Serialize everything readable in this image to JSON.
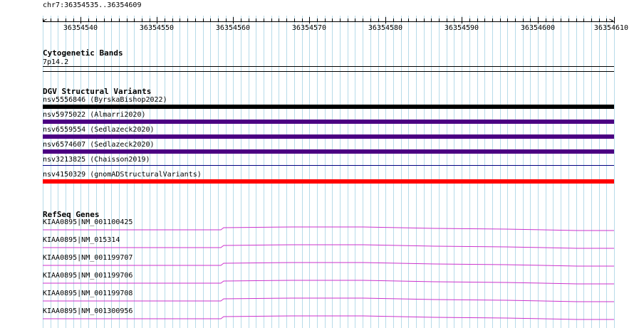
{
  "browser": {
    "position": "chr7:36354535..36354609",
    "ruler_ticks": [
      "36354540",
      "36354550",
      "36354560",
      "36354570",
      "36354580",
      "36354590",
      "36354600",
      "36354610"
    ]
  },
  "tracks": {
    "cytobands": {
      "title": "Cytogenetic Bands",
      "band": "7p14.2"
    },
    "dgv": {
      "title": "DGV Structural Variants",
      "items": [
        {
          "label": "nsv5556846 (ByrskaBishop2022)",
          "color": "#000000"
        },
        {
          "label": "nsv5975022 (Almarri2020)",
          "color": "#4b0082"
        },
        {
          "label": "nsv6559554 (Sedlazeck2020)",
          "color": "#4b0082"
        },
        {
          "label": "nsv6574607 (Sedlazeck2020)",
          "color": "#4b0082"
        },
        {
          "label": "nsv3213825 (Chaisson2019)",
          "color": "#000080"
        },
        {
          "label": "nsv4150329 (gnomADStructuralVariants)",
          "color": "#ff0000"
        }
      ]
    },
    "refseq": {
      "title": "RefSeq Genes",
      "line_color": "#cc33cc",
      "items": [
        {
          "label": "KIAA0895|NM_001100425"
        },
        {
          "label": "KIAA0895|NM_015314"
        },
        {
          "label": "KIAA0895|NM_001199707"
        },
        {
          "label": "KIAA0895|NM_001199706"
        },
        {
          "label": "KIAA0895|NM_001199708"
        },
        {
          "label": "KIAA0895|NM_001300956"
        }
      ]
    }
  }
}
